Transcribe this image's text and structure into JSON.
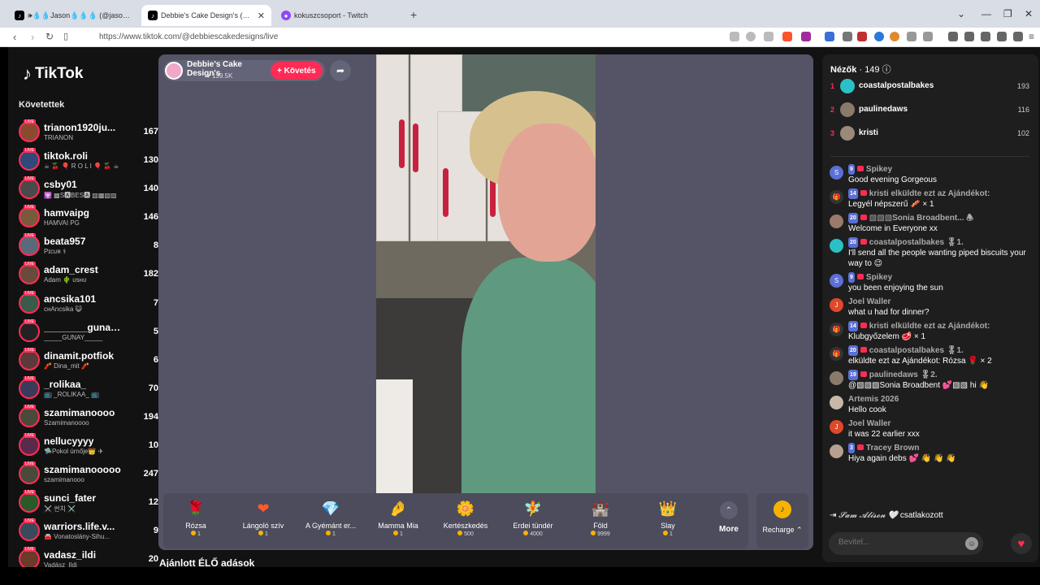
{
  "browser": {
    "tabs": [
      {
        "label": "🕪💧💧Jason💧💧💧 (@jason_sar",
        "active": false
      },
      {
        "label": "Debbie's Cake Design's (@de",
        "active": true
      },
      {
        "label": "kokuszcsoport - Twitch",
        "active": false
      }
    ],
    "new_tab": "+",
    "url": "https://www.tiktok.com/@debbiescakedesigns/live"
  },
  "sidebar": {
    "logo": "TikTok",
    "following_title": "Követettek",
    "items": [
      {
        "name": "trianon1920ju...",
        "sub": "TRIANON",
        "count": "167",
        "color": "#8a4a2f"
      },
      {
        "name": "tiktok.roli",
        "sub": "☕ 🍒 🎈 R O L I 🎈 🍒 ☕",
        "count": "130",
        "color": "#2f4a7a"
      },
      {
        "name": "csby01",
        "sub": "🕎 ▩S🅰BES🅰 ▧▩▧▨",
        "count": "140",
        "color": "#4a4a4a"
      },
      {
        "name": "hamvaipg",
        "sub": "HAMVAI PG",
        "count": "146",
        "color": "#7a5a3a"
      },
      {
        "name": "beata957",
        "sub": "Pɪcᴜʀ ⚕",
        "count": "8",
        "color": "#5a6a7a"
      },
      {
        "name": "adam_crest",
        "sub": "Adam 🌵 ᴜsнᴜ",
        "count": "182",
        "color": "#6a4a3a"
      },
      {
        "name": "ancsika101",
        "sub": "cнAncsika 😺",
        "count": "7",
        "color": "#3a5a4a"
      },
      {
        "name": "________gunay...",
        "sub": "_____GUNAY_____",
        "count": "5",
        "color": "#222222"
      },
      {
        "name": "dinamit.potfiok",
        "sub": "🧨 Dina_mit 🧨",
        "count": "6",
        "color": "#5a3a3a"
      },
      {
        "name": "_rolikaa_",
        "sub": "📺 _ROLIKAA_ 📺",
        "count": "70",
        "color": "#3a3a5a"
      },
      {
        "name": "szamimanoooo",
        "sub": "Szamimanoooo",
        "count": "194",
        "color": "#4a4a3a"
      },
      {
        "name": "nellucyyyy",
        "sub": "🛸Pokol úrnője👑 ✈",
        "count": "10",
        "color": "#5a2a4a"
      },
      {
        "name": "szamimanooooo",
        "sub": "szamimanooo",
        "count": "247",
        "color": "#4a4a3a"
      },
      {
        "name": "sunci_fater",
        "sub": "⚔️ 썬치 ⚔️",
        "count": "12",
        "color": "#2a5a2a"
      },
      {
        "name": "warriors.life.v...",
        "sub": "🚘 Vonatoslány-Sihu...",
        "count": "9",
        "color": "#3a4a5a"
      },
      {
        "name": "vadasz_ildi",
        "sub": "Vadász_Ildi",
        "count": "20",
        "color": "#6a3a2a"
      }
    ]
  },
  "stream": {
    "streamer_name": "Debbie's Cake Design's",
    "likes": "♥ 139.5K",
    "follow_label": "+ Követés",
    "share_icon": "share-icon"
  },
  "gifts": [
    {
      "name": "Rózsa",
      "price": "1",
      "icon": "🌹",
      "color": "#c8213f"
    },
    {
      "name": "Lángoló szív",
      "price": "1",
      "icon": "❤",
      "color": "#ff5a2a"
    },
    {
      "name": "A Gyémánt er...",
      "price": "1",
      "icon": "💎",
      "color": "#e0c060"
    },
    {
      "name": "Mamma Mia",
      "price": "1",
      "icon": "🤌",
      "color": "#f0b0a0"
    },
    {
      "name": "Kertészkedés",
      "price": "500",
      "icon": "🌼",
      "color": "#f0d030"
    },
    {
      "name": "Erdei tündér",
      "price": "4000",
      "icon": "🧚",
      "color": "#60b080"
    },
    {
      "name": "Föld",
      "price": "9999",
      "icon": "🏰",
      "color": "#8090a0"
    },
    {
      "name": "Slay",
      "price": "1",
      "icon": "👑",
      "color": "#f0a040"
    }
  ],
  "more_label": "More",
  "recharge_label": "Recharge ⌃",
  "recommended_title": "Ajánlott ÉLŐ adások",
  "chat": {
    "viewers_label": "Nézők",
    "viewers_count": "· 149",
    "top_viewers": [
      {
        "rank": "1",
        "name": "coastalpostalbakes",
        "score": "193",
        "color": "#2bbfc6"
      },
      {
        "rank": "2",
        "name": "paulinedaws",
        "score": "116",
        "color": "#8a7a6a"
      },
      {
        "rank": "3",
        "name": "kristi",
        "score": "102",
        "color": "#9a8a7a"
      }
    ],
    "messages": [
      {
        "head": "Spikey",
        "level": "9",
        "text": "Good evening Gorgeous",
        "avatar": "S",
        "color": "#5b6fd6"
      },
      {
        "head": "kristi elküldte ezt az Ajándékot:",
        "level": "14",
        "text": "Legyél népszerű 🥓 × 1",
        "avatar": "🎁",
        "color": "#333333"
      },
      {
        "head": "▧▧▧Sonia Broadbent... 🕭",
        "level": "20",
        "text": "Welcome in Everyone xx",
        "avatar": "",
        "color": "#9a7a6a"
      },
      {
        "head": "coastalpostalbakes 🎖1.",
        "level": "20",
        "text": "I'll send all the people wanting piped biscuits your way to 😉",
        "avatar": "",
        "color": "#2bbfc6"
      },
      {
        "head": "Spikey",
        "level": "9",
        "text": "you been enjoying the sun",
        "avatar": "S",
        "color": "#5b6fd6"
      },
      {
        "head": "Joel Waller",
        "level": "",
        "text": "what u had for dinner?",
        "avatar": "J",
        "color": "#e0482a"
      },
      {
        "head": "kristi elküldte ezt az Ajándékot:",
        "level": "14",
        "text": "Klubgyőzelem 🥩 × 1",
        "avatar": "🎁",
        "color": "#333333"
      },
      {
        "head": "coastalpostalbakes 🎖1.",
        "level": "20",
        "text": "elküldte ezt az Ajándékot: Rózsa 🌹 × 2",
        "avatar": "🎁",
        "color": "#333333"
      },
      {
        "head": "paulinedaws 🎖2.",
        "level": "19",
        "text": "@▧▧▧Sonia Broadbent 💕▧▧ hi 👋",
        "avatar": "",
        "color": "#8a7a6a"
      },
      {
        "head": "Artemis 2026",
        "level": "",
        "text": "Hello cook",
        "avatar": "",
        "color": "#c8b8a8"
      },
      {
        "head": "Joel Waller",
        "level": "",
        "text": "it was 22 earlier xxx",
        "avatar": "J",
        "color": "#e0482a"
      },
      {
        "head": "Tracey Brown",
        "level": "3",
        "text": "Hiya again debs 💕 👋 👋 👋",
        "avatar": "",
        "color": "#b8a090"
      }
    ],
    "joined_name": "𝓢𝓪𝓶 𝓐𝓵𝓲𝓼𝓸𝓷 🤍",
    "joined_text": "csatlakozott",
    "input_placeholder": "Bevitel..."
  }
}
